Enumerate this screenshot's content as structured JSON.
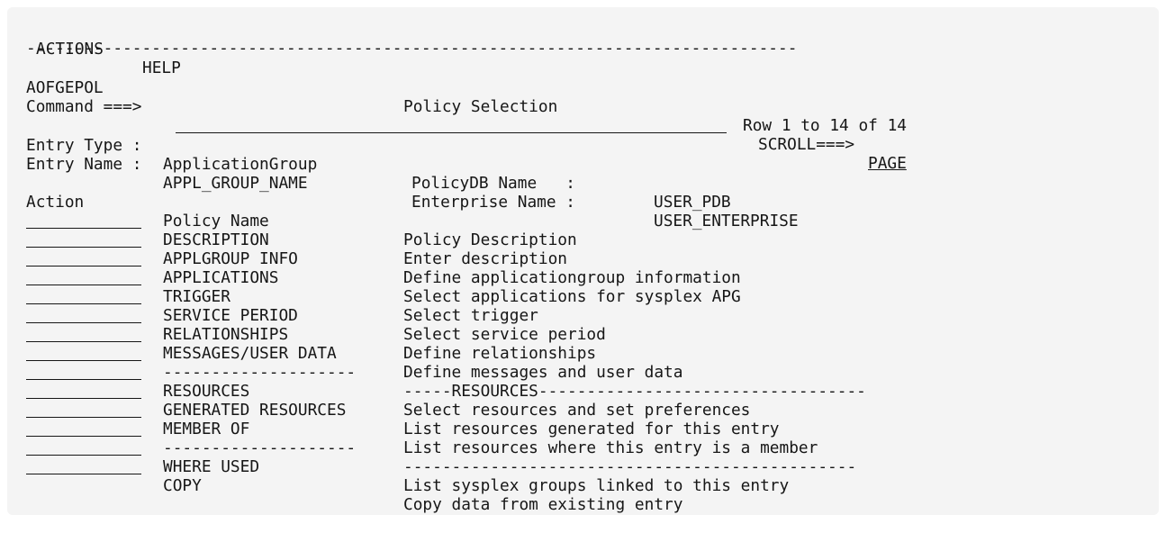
{
  "menu": {
    "actions": "ACTIONS",
    "help": "HELP"
  },
  "divider": "--------------------------------------------------------------------------------",
  "header": {
    "panel_id": "AOFGEPOL",
    "title": "Policy Selection",
    "row_info": "Row 1 to 14 of 14",
    "command_label": "Command ===>",
    "command_value": "",
    "scroll_label": "SCROLL===>",
    "scroll_value": "PAGE"
  },
  "info": {
    "entry_type_label": "Entry Type :",
    "entry_type_value": "ApplicationGroup",
    "entry_name_label": "Entry Name :",
    "entry_name_value": "APPL_GROUP_NAME",
    "policydb_label": "PolicyDB Name   :",
    "policydb_value": "USER_PDB",
    "enterprise_label": "Enterprise Name :",
    "enterprise_value": "USER_ENTERPRISE"
  },
  "table": {
    "headers": {
      "action": "Action",
      "name": "Policy Name",
      "description": "Policy Description"
    },
    "rows": [
      {
        "name": "DESCRIPTION",
        "description": "Enter description"
      },
      {
        "name": "APPLGROUP INFO",
        "description": "Define applicationgroup information"
      },
      {
        "name": "APPLICATIONS",
        "description": "Select applications for sysplex APG"
      },
      {
        "name": "TRIGGER",
        "description": "Select trigger"
      },
      {
        "name": "SERVICE PERIOD",
        "description": "Select service period"
      },
      {
        "name": "RELATIONSHIPS",
        "description": "Define relationships"
      },
      {
        "name": "MESSAGES/USER DATA",
        "description": "Define messages and user data"
      },
      {
        "name": "--------------------",
        "description": "-----RESOURCES----------------------------------"
      },
      {
        "name": "RESOURCES",
        "description": "Select resources and set preferences"
      },
      {
        "name": "GENERATED RESOURCES",
        "description": "List resources generated for this entry"
      },
      {
        "name": "MEMBER OF",
        "description": "List resources where this entry is a member"
      },
      {
        "name": "--------------------",
        "description": "-----------------------------------------------"
      },
      {
        "name": "WHERE USED",
        "description": "List sysplex groups linked to this entry"
      },
      {
        "name": "COPY",
        "description": "Copy data from existing entry"
      }
    ]
  }
}
